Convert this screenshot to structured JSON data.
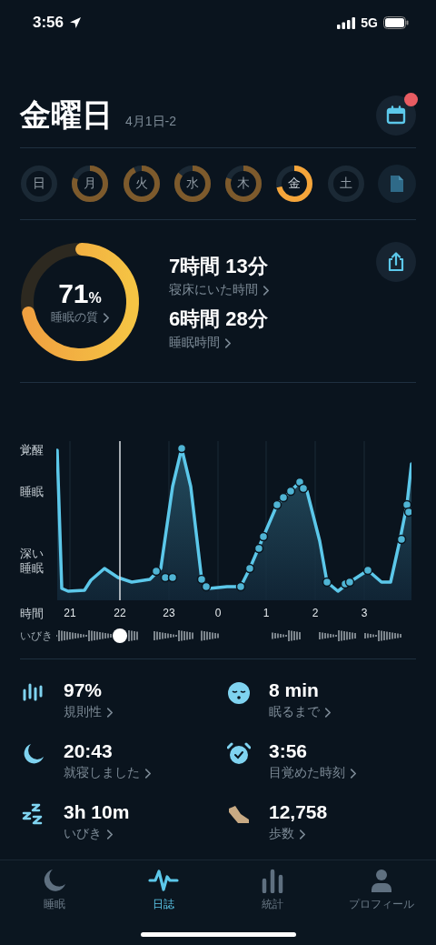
{
  "status_bar": {
    "time": "3:56",
    "network": "5G"
  },
  "header": {
    "title": "金曜日",
    "date": "4月1日-2",
    "notification": true
  },
  "week": [
    {
      "label": "日",
      "selected": false
    },
    {
      "label": "月",
      "level": 0.8,
      "selected": false
    },
    {
      "label": "火",
      "level": 0.92,
      "selected": false
    },
    {
      "label": "水",
      "level": 0.85,
      "selected": false
    },
    {
      "label": "木",
      "level": 0.8,
      "selected": false
    },
    {
      "label": "金",
      "level": 0.71,
      "selected": true
    },
    {
      "label": "土",
      "selected": false
    }
  ],
  "summary": {
    "quality": {
      "value": "71",
      "unit": "%",
      "label": "睡眠の質",
      "level": 0.71
    },
    "metrics": [
      {
        "value": "7時間 13分",
        "label": "寝床にいた時間"
      },
      {
        "value": "6時間 28分",
        "label": "睡眠時間"
      }
    ]
  },
  "sleep_graph": {
    "levels": [
      "覚醒",
      "睡眠",
      "深い睡眠"
    ],
    "axis_label": "時間",
    "hours": [
      "21",
      "22",
      "23",
      "0",
      "1",
      "2",
      "3"
    ],
    "snore_label": "いびき"
  },
  "stats": [
    {
      "value": "97%",
      "label": "規則性"
    },
    {
      "value": "8 min",
      "label": "眠るまで"
    },
    {
      "value": "20:43",
      "label": "就寝しました"
    },
    {
      "value": "3:56",
      "label": "目覚めた時刻"
    },
    {
      "value": "3h 10m",
      "label": "いびき"
    },
    {
      "value": "12,758",
      "label": "歩数"
    }
  ],
  "tabs": [
    {
      "label": "睡眠",
      "selected": false
    },
    {
      "label": "日誌",
      "selected": true
    },
    {
      "label": "統計",
      "selected": false
    },
    {
      "label": "プロフィール",
      "selected": false
    }
  ]
}
